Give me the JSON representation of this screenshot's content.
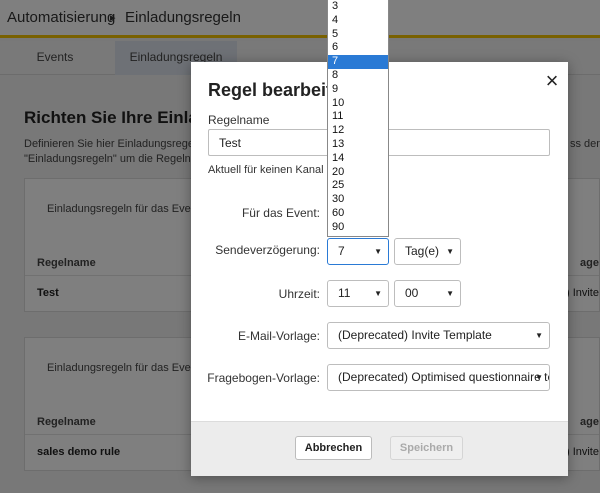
{
  "header": {
    "breadcrumb_root": "Automatisierung",
    "breadcrumb_separator": "▸",
    "breadcrumb_current": "Einladungsregeln"
  },
  "tabs": [
    {
      "label": "Events"
    },
    {
      "label": "Einladungsregeln"
    }
  ],
  "content": {
    "title": "Richten Sie Ihre Einlad",
    "desc_line1": "Definieren Sie hier Einladungsregeln",
    "desc_line2": "\"Einladungsregeln\" um die Regeln zu",
    "desc_right": "ss den"
  },
  "cards": [
    {
      "header": "Einladungsregeln für das Event",
      "col_name": "Regelname",
      "col_right": "age",
      "row_name": "Test",
      "row_right": "l) Invite"
    },
    {
      "header": "Einladungsregeln für das Event",
      "col_name": "Regelname",
      "col_right": "age",
      "row_name": "sales demo rule",
      "row_right": "l) Invite"
    }
  ],
  "modal": {
    "title": "Regel bearbeiten",
    "close_icon": "×",
    "name_label": "Regelname",
    "name_value": "Test",
    "status_text": "Aktuell für keinen Kanal a",
    "event_label": "Für das Event:",
    "delay_label": "Sendeverzögerung:",
    "delay_value": "7",
    "delay_unit": "Tag(e)",
    "time_label": "Uhrzeit:",
    "time_hour": "11",
    "time_minute": "00",
    "email_label": "E-Mail-Vorlage:",
    "email_value": "(Deprecated) Invite Template",
    "survey_label": "Fragebogen-Vorlage:",
    "survey_value": "(Deprecated) Optimised questionnaire tem",
    "cancel_label": "Abbrechen",
    "save_label": "Speichern"
  },
  "dropdown": {
    "options": [
      "3",
      "4",
      "5",
      "6",
      "7",
      "8",
      "9",
      "10",
      "11",
      "12",
      "13",
      "14",
      "20",
      "25",
      "30",
      "60",
      "90"
    ],
    "selected": "7"
  },
  "colors": {
    "accent_yellow": "#f2c200",
    "selection_blue": "#2a7ad5"
  }
}
